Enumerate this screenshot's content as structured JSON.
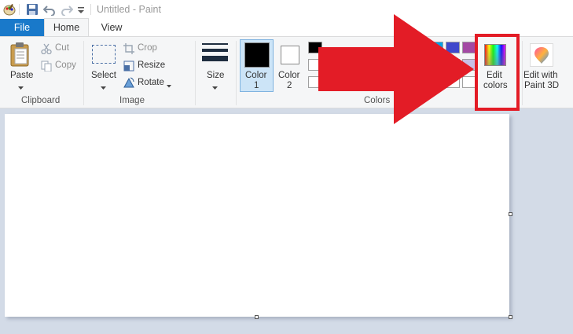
{
  "app": {
    "title": "Untitled - Paint"
  },
  "tabs": [
    {
      "label": "File"
    },
    {
      "label": "Home"
    },
    {
      "label": "View"
    }
  ],
  "clipboard": {
    "paste": "Paste",
    "cut": "Cut",
    "copy": "Copy",
    "group_label": "Clipboard"
  },
  "image": {
    "select": "Select",
    "crop": "Crop",
    "resize": "Resize",
    "rotate": "Rotate",
    "group_label": "Image"
  },
  "size": {
    "label": "Size"
  },
  "colors": {
    "color1_line1": "Color",
    "color1_line2": "1",
    "color2_line1": "Color",
    "color2_line2": "2",
    "group_label": "Colors",
    "color1_value": "#000000",
    "color2_value": "#ffffff",
    "edit_colors_line1": "Edit",
    "edit_colors_line2": "colors"
  },
  "paint3d": {
    "line1": "Edit with",
    "line2": "Paint 3D"
  },
  "annotation": {
    "arrow_color": "#e31c26",
    "highlight_color": "#e31c26"
  },
  "icons": [
    "paint-app-icon",
    "save-icon",
    "undo-icon",
    "redo-icon",
    "customize-dropdown-icon",
    "paste-icon",
    "cut-icon",
    "copy-icon",
    "select-icon",
    "crop-icon",
    "resize-icon",
    "rotate-icon",
    "size-icon",
    "edit-colors-icon",
    "paint3d-icon"
  ]
}
